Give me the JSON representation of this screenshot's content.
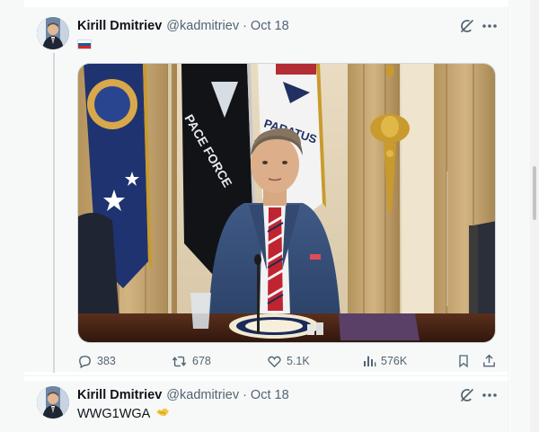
{
  "posts": [
    {
      "author": {
        "display_name": "Kirill Dmitriev",
        "handle": "@kadmitriev"
      },
      "date": "Oct 18",
      "separator": "·",
      "flag": [
        "#ffffff",
        "#1c57a5",
        "#d52b1e"
      ],
      "media_icon": "photo",
      "stats": {
        "replies": "383",
        "reposts": "678",
        "likes": "5.1K",
        "views": "576K"
      }
    },
    {
      "author": {
        "display_name": "Kirill Dmitriev",
        "handle": "@kadmitriev"
      },
      "date": "Oct 18",
      "separator": "·",
      "text": "WWG1WGA",
      "emoji_icon": "handshake-emoji"
    }
  ],
  "icons": {
    "grok": "grok-icon",
    "more": "more-icon",
    "reply": "reply-icon",
    "repost": "repost-icon",
    "like": "heart-icon",
    "views": "views-icon",
    "bookmark": "bookmark-icon",
    "share": "share-icon"
  },
  "colors": {
    "muted_text": "#536471",
    "panel_bg": "#f7f9f9",
    "thread_line": "#cfd9de"
  }
}
